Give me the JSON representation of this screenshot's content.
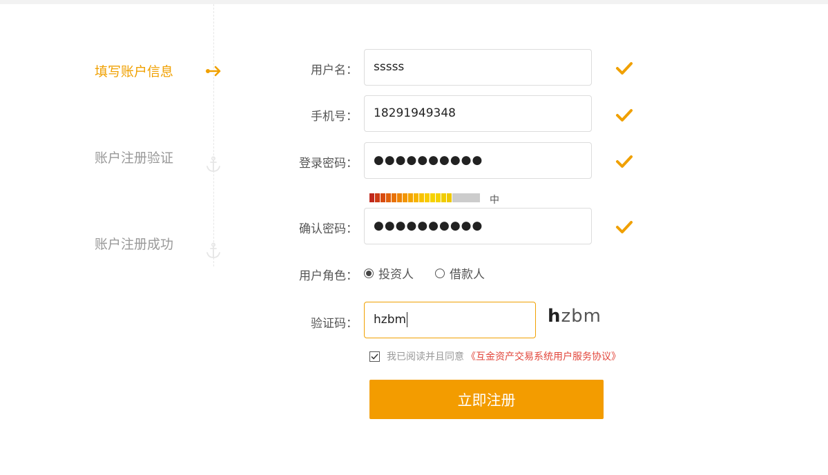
{
  "steps": [
    {
      "label": "填写账户信息",
      "active": true
    },
    {
      "label": "账户注册验证",
      "active": false
    },
    {
      "label": "账户注册成功",
      "active": false
    }
  ],
  "form": {
    "username": {
      "label": "用户名：",
      "value": "sssss"
    },
    "phone": {
      "label": "手机号：",
      "value": "18291949348"
    },
    "password": {
      "label": "登录密码：",
      "value": "●●●●●●●●●●"
    },
    "strength": {
      "label": "中",
      "level": 0.75
    },
    "confirm": {
      "label": "确认密码：",
      "value": "●●●●●●●●●●"
    },
    "role": {
      "label": "用户角色：",
      "options": [
        {
          "label": "投资人",
          "selected": true
        },
        {
          "label": "借款人",
          "selected": false
        }
      ]
    },
    "captcha": {
      "label": "验证码：",
      "value": "hzbm",
      "image_text_first": "h",
      "image_text_rest": "zbm"
    },
    "agreement": {
      "checked": true,
      "text": "我已阅读并且同意",
      "link": "《互金资产交易系统用户服务协议》"
    },
    "submit_label": "立即注册"
  },
  "colors": {
    "accent": "#f39c00",
    "check": "#f0a000",
    "link": "#e2463b"
  }
}
